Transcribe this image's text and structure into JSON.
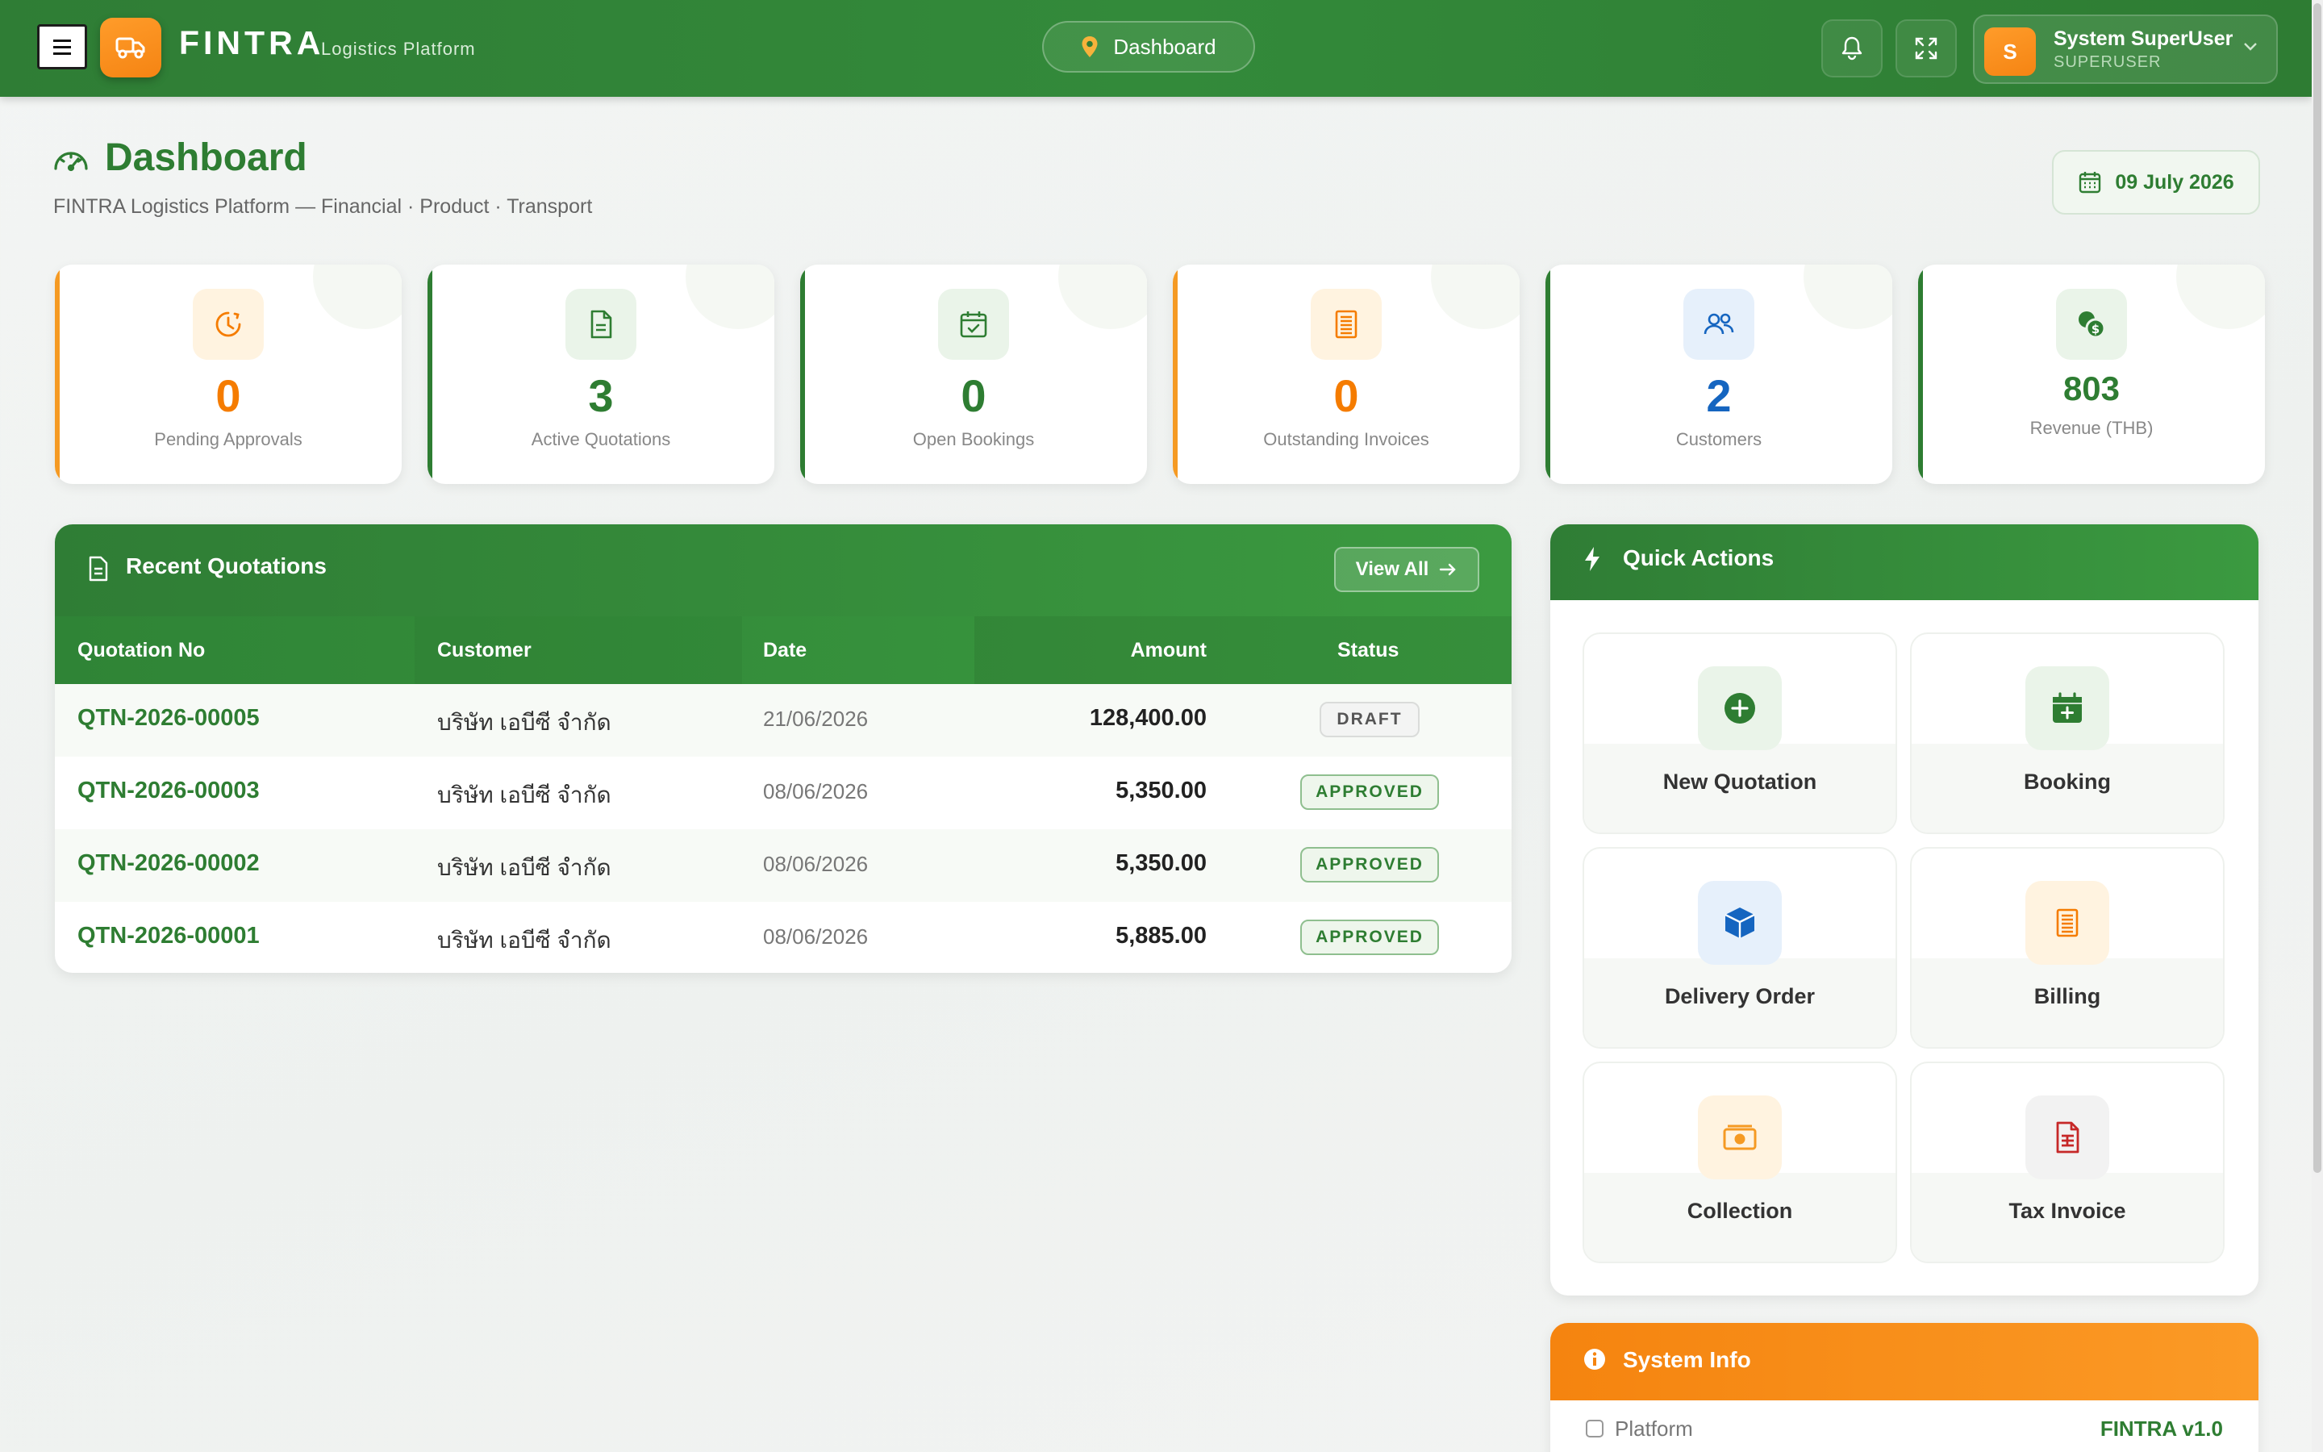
{
  "header": {
    "brand": "FINTRA",
    "brand_sub": "Logistics Platform",
    "breadcrumb": "Dashboard",
    "user_name": "System SuperUser",
    "user_role": "SUPERUSER",
    "avatar_initial": "S"
  },
  "page": {
    "title": "Dashboard",
    "subtitle": "FINTRA Logistics Platform — Financial · Product · Transport",
    "date": "09 July 2026"
  },
  "stats": [
    {
      "value": "0",
      "label": "Pending Approvals",
      "icon": "clock-icon",
      "color": "#f57c00",
      "accent": "#f59a23",
      "bg": "#fff3e0"
    },
    {
      "value": "3",
      "label": "Active Quotations",
      "icon": "document-icon",
      "color": "#2e7d32",
      "accent": "#2e7d32",
      "bg": "#eaf4e9"
    },
    {
      "value": "0",
      "label": "Open Bookings",
      "icon": "calendar-check-icon",
      "color": "#2e7d32",
      "accent": "#2e7d32",
      "bg": "#eaf4e9"
    },
    {
      "value": "0",
      "label": "Outstanding Invoices",
      "icon": "receipt-icon",
      "color": "#f57c00",
      "accent": "#f59a23",
      "bg": "#fff3e0"
    },
    {
      "value": "2",
      "label": "Customers",
      "icon": "users-icon",
      "color": "#1565c0",
      "accent": "#2e7d32",
      "bg": "#e6f0fb"
    },
    {
      "value": "803",
      "label": "Revenue (THB)",
      "icon": "money-icon",
      "color": "#2e7d32",
      "accent": "#2e7d32",
      "bg": "#eaf4e9"
    }
  ],
  "quotations": {
    "title": "Recent Quotations",
    "view_all": "View All",
    "columns": [
      "Quotation No",
      "Customer",
      "Date",
      "Amount",
      "Status"
    ],
    "rows": [
      {
        "no": "QTN-2026-00005",
        "customer": "บริษัท เอบีซี จำกัด",
        "date": "21/06/2026",
        "amount": "128,400.00",
        "status": "DRAFT"
      },
      {
        "no": "QTN-2026-00003",
        "customer": "บริษัท เอบีซี จำกัด",
        "date": "08/06/2026",
        "amount": "5,350.00",
        "status": "APPROVED"
      },
      {
        "no": "QTN-2026-00002",
        "customer": "บริษัท เอบีซี จำกัด",
        "date": "08/06/2026",
        "amount": "5,350.00",
        "status": "APPROVED"
      },
      {
        "no": "QTN-2026-00001",
        "customer": "บริษัท เอบีซี จำกัด",
        "date": "08/06/2026",
        "amount": "5,885.00",
        "status": "APPROVED"
      }
    ]
  },
  "quick_actions": {
    "title": "Quick Actions",
    "items": [
      {
        "label": "New Quotation",
        "icon": "plus-circle-icon",
        "color": "#2e7d32",
        "bg": "#eaf4e9"
      },
      {
        "label": "Booking",
        "icon": "calendar-plus-icon",
        "color": "#2e7d32",
        "bg": "#eaf4e9"
      },
      {
        "label": "Delivery Order",
        "icon": "box-icon",
        "color": "#1565c0",
        "bg": "#e6f0fb"
      },
      {
        "label": "Billing",
        "icon": "receipt-icon",
        "color": "#f57c00",
        "bg": "#fff3e0"
      },
      {
        "label": "Collection",
        "icon": "cash-icon",
        "color": "#f59a23",
        "bg": "#fff3e0"
      },
      {
        "label": "Tax Invoice",
        "icon": "file-invoice-icon",
        "color": "#c62828",
        "bg": "#f2f2f2"
      }
    ]
  },
  "system_info": {
    "title": "System Info",
    "rows": [
      {
        "key": "Platform",
        "value": "FINTRA v1.0"
      }
    ]
  }
}
